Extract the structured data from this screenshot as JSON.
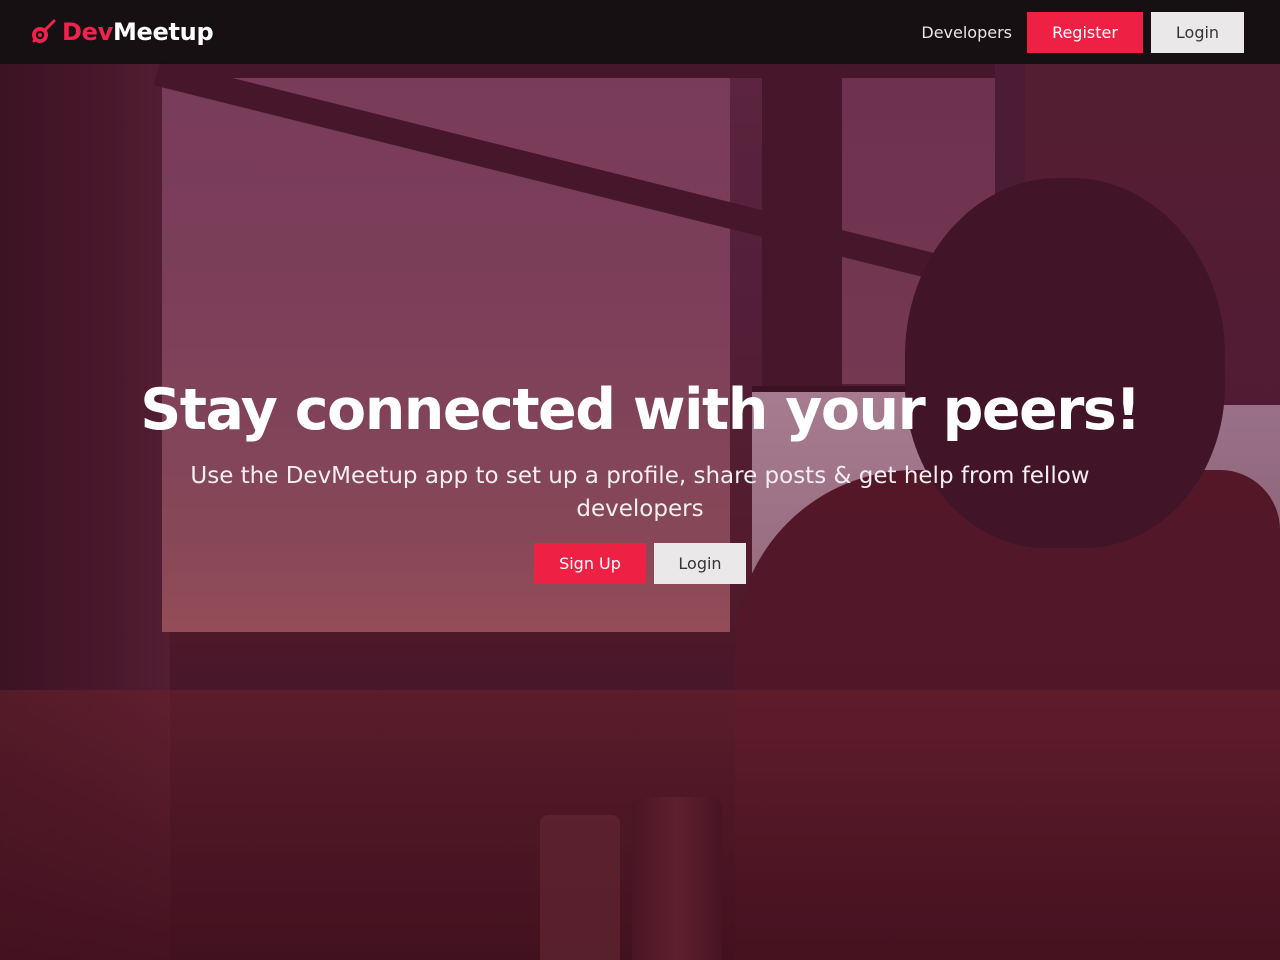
{
  "navbar": {
    "brand": {
      "accent": "Dev",
      "rest": "Meetup",
      "icon": "meteor-icon"
    },
    "links": {
      "developers": "Developers"
    },
    "register_label": "Register",
    "login_label": "Login"
  },
  "hero": {
    "title": "Stay connected with your peers!",
    "lead": "Use the DevMeetup app to set up a profile, share posts & get help from fellow developers",
    "signup_label": "Sign Up",
    "login_label": "Login"
  },
  "colors": {
    "accent": "#ee2145",
    "navbar_bg": "#141012",
    "light_button": "#ebe8ea"
  }
}
